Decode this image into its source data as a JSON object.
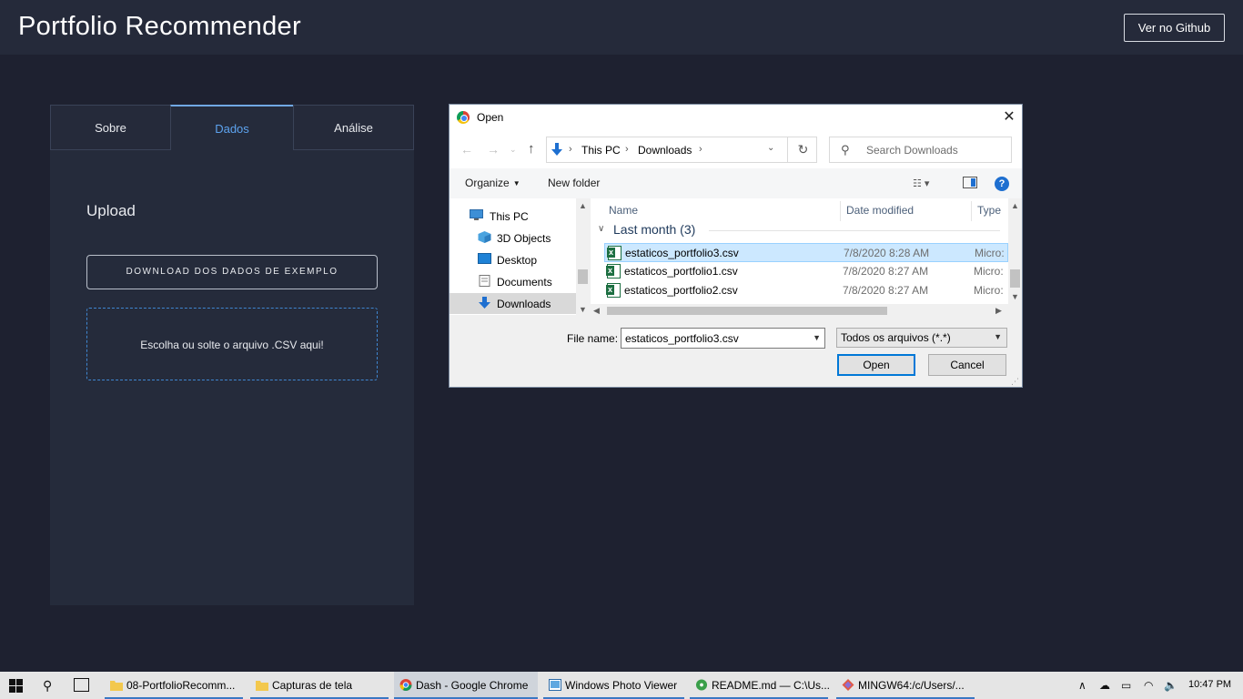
{
  "app": {
    "title": "Portfolio Recommender",
    "github_button": "Ver no Github"
  },
  "tabs": [
    {
      "label": "Sobre",
      "active": false
    },
    {
      "label": "Dados",
      "active": true
    },
    {
      "label": "Análise",
      "active": false
    }
  ],
  "upload": {
    "title": "Upload",
    "download_button": "DOWNLOAD DOS DADOS DE EXEMPLO",
    "dropzone_text": "Escolha ou solte o arquivo .CSV aqui!"
  },
  "dialog": {
    "title": "Open",
    "breadcrumb": [
      "This PC",
      "Downloads"
    ],
    "search_placeholder": "Search Downloads",
    "toolbar": {
      "organize": "Organize",
      "new_folder": "New folder",
      "help": "?"
    },
    "nav_items": [
      {
        "label": "This PC",
        "icon": "computer-icon",
        "selected": false
      },
      {
        "label": "3D Objects",
        "icon": "cube-icon",
        "selected": false
      },
      {
        "label": "Desktop",
        "icon": "desktop-icon",
        "selected": false
      },
      {
        "label": "Documents",
        "icon": "documents-icon",
        "selected": false
      },
      {
        "label": "Downloads",
        "icon": "download-arrow-icon",
        "selected": true
      }
    ],
    "columns": {
      "name": "Name",
      "date_modified": "Date modified",
      "type": "Type"
    },
    "group": "Last month (3)",
    "files": [
      {
        "name": "estaticos_portfolio3.csv",
        "date": "7/8/2020 8:28 AM",
        "type": "Micro:",
        "selected": true
      },
      {
        "name": "estaticos_portfolio1.csv",
        "date": "7/8/2020 8:27 AM",
        "type": "Micro:",
        "selected": false
      },
      {
        "name": "estaticos_portfolio2.csv",
        "date": "7/8/2020 8:27 AM",
        "type": "Micro:",
        "selected": false
      }
    ],
    "file_name_label": "File name:",
    "file_name_value": "estaticos_portfolio3.csv",
    "file_type_value": "Todos os arquivos (*.*)",
    "open_button": "Open",
    "cancel_button": "Cancel"
  },
  "taskbar": {
    "items": [
      {
        "label": "08-PortfolioRecomm...",
        "icon": "folder-icon",
        "active": false
      },
      {
        "label": "Capturas de tela",
        "icon": "folder-icon",
        "active": false
      },
      {
        "label": "Dash - Google Chrome",
        "icon": "chrome-icon",
        "active": true
      },
      {
        "label": "Windows Photo Viewer",
        "icon": "photo-viewer-icon",
        "active": false
      },
      {
        "label": "README.md — C:\\Us...",
        "icon": "atom-icon",
        "active": false
      },
      {
        "label": "MINGW64:/c/Users/...",
        "icon": "git-bash-icon",
        "active": false
      }
    ],
    "clock": "10:47 PM"
  },
  "colors": {
    "page_bg": "#1e2130",
    "header_bg": "#252a3a",
    "panel_bg": "#252b3b",
    "accent": "#5da3ef",
    "selection": "#cce8ff",
    "excel_green": "#1d6f42"
  }
}
